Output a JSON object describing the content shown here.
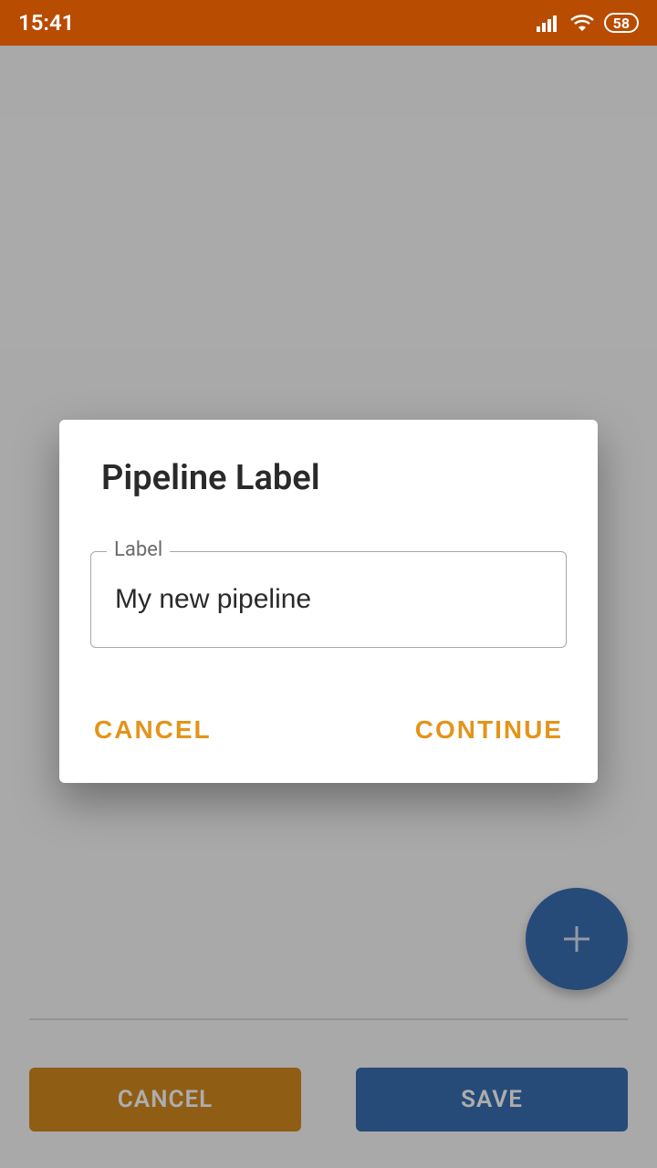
{
  "status": {
    "time": "15:41",
    "battery": "58"
  },
  "dialog": {
    "title": "Pipeline Label",
    "field_label": "Label",
    "field_value": "My new pipeline",
    "cancel": "CANCEL",
    "continue": "CONTINUE"
  },
  "footer": {
    "cancel": "CANCEL",
    "save": "SAVE"
  }
}
